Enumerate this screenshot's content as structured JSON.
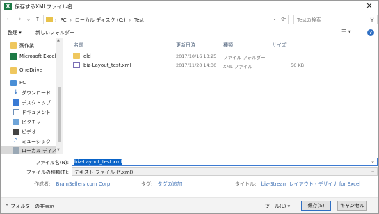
{
  "window": {
    "title": "保存するXMLファイル名",
    "close_glyph": "✕",
    "app_icon_letter": "X"
  },
  "nav": {
    "back_glyph": "←",
    "forward_glyph": "→",
    "recent_glyph": "⌄",
    "up_glyph": "↑",
    "breadcrumbs": [
      "PC",
      "ローカル ディスク (C:)",
      "Test"
    ],
    "breadcrumb_sep": "›",
    "search_placeholder": "Testの検索"
  },
  "toolbar": {
    "organize": "整理 ▾",
    "new_folder": "新しいフォルダー",
    "view_glyph": "☰ ▾",
    "help_glyph": "?"
  },
  "sidebar": {
    "items": [
      {
        "label": "残作業",
        "icon": "folder"
      },
      {
        "label": "Microsoft Excel",
        "icon": "excel"
      },
      {
        "label": "OneDrive",
        "icon": "folder"
      },
      {
        "label": "PC",
        "icon": "pc"
      },
      {
        "label": "ダウンロード",
        "icon": "download"
      },
      {
        "label": "デスクトップ",
        "icon": "desktop"
      },
      {
        "label": "ドキュメント",
        "icon": "documents"
      },
      {
        "label": "ピクチャ",
        "icon": "pictures"
      },
      {
        "label": "ビデオ",
        "icon": "video"
      },
      {
        "label": "ミュージック",
        "icon": "music"
      },
      {
        "label": "ローカル ディスク (C",
        "icon": "drive"
      }
    ],
    "download_glyph": "↓",
    "music_glyph": "♪",
    "collapse_glyph": "⌄"
  },
  "filelist": {
    "columns": [
      "名前",
      "更新日時",
      "種類",
      "サイズ"
    ],
    "rows": [
      {
        "name": "old",
        "modified": "2017/10/16 13:25",
        "type": "ファイル フォルダー",
        "size": "",
        "icon": "folder"
      },
      {
        "name": "biz-Layout_test.xml",
        "modified": "2017/11/20 14:30",
        "type": "XML ファイル",
        "size": "56 KB",
        "icon": "xml-file"
      }
    ]
  },
  "form": {
    "filename_label": "ファイル名(N):",
    "filename_value": "biz-Layout_test.xml",
    "filetype_label": "ファイルの種類(T):",
    "filetype_value": "テキスト ファイル (*.xml)",
    "dropdown_glyph": "⌄",
    "author_label": "作成者:",
    "author_value": "BrainSellers.com Corp.",
    "tags_label": "タグ:",
    "tags_value": "タグの追加",
    "title_label": "タイトル:",
    "title_value": "biz-Stream レイアウト・デザイナ for Excel"
  },
  "footer": {
    "hide_folders": "フォルダーの非表示",
    "collapse_glyph": "⌃",
    "tools": "ツール(L) ▾",
    "save": "保存(S)",
    "cancel": "キャンセル"
  },
  "colors": {
    "accent": "#0a64c8",
    "folder": "#efc75e",
    "excel": "#1d7a45",
    "link": "#3c6fb4"
  }
}
